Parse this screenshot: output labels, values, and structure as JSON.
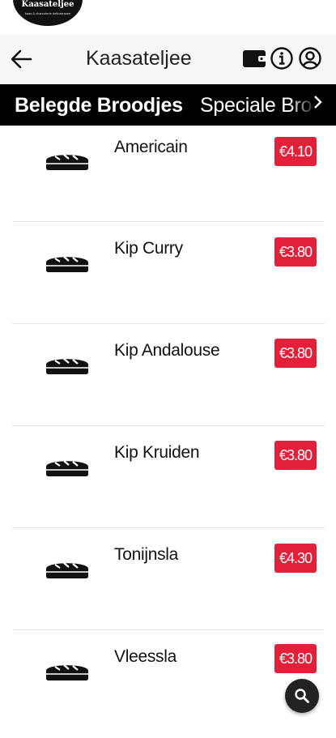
{
  "logo": {
    "line1": "Kaasateljee",
    "line2": "kaas & charcuterie delicatessen"
  },
  "header": {
    "title": "Kaasateljee",
    "icons": [
      "back-arrow-icon",
      "wallet-icon",
      "info-icon",
      "account-icon"
    ]
  },
  "tabs": [
    {
      "label": "Belegde Broodjes",
      "active": true
    },
    {
      "label": "Speciale Bro",
      "active": false
    }
  ],
  "products": [
    {
      "name": "Americain",
      "price": "€4.10",
      "icon": "bread-icon"
    },
    {
      "name": "Kip Curry",
      "price": "€3.80",
      "icon": "bread-icon"
    },
    {
      "name": "Kip Andalouse",
      "price": "€3.80",
      "icon": "bread-icon"
    },
    {
      "name": "Kip Kruiden",
      "price": "€3.80",
      "icon": "bread-icon"
    },
    {
      "name": "Tonijnsla",
      "price": "€4.30",
      "icon": "bread-icon"
    },
    {
      "name": "Vleessla",
      "price": "€3.80",
      "icon": "bread-icon"
    }
  ],
  "colors": {
    "price_badge": "#e3203a",
    "tab_bar": "#000000",
    "header_bg": "#f6f6f6",
    "fab": "#222222"
  },
  "fab": {
    "icon": "search-icon"
  }
}
